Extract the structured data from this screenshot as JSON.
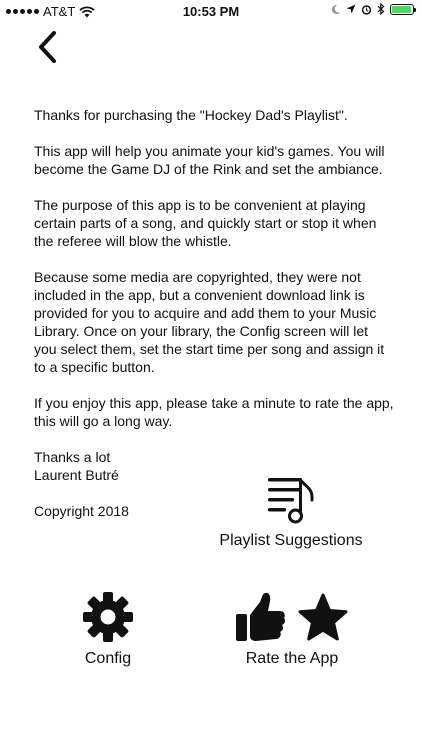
{
  "status_bar": {
    "carrier": "AT&T",
    "time": "10:53 PM",
    "battery_level": 0.95,
    "battery_color": "#4cd964"
  },
  "nav": {
    "back_icon": "chevron-left-icon"
  },
  "content": {
    "paragraphs": [
      "Thanks for purchasing the \"Hockey Dad's Playlist\".",
      "This app will help you animate your kid's games. You will become the Game DJ of the Rink and set the ambiance.",
      "The purpose of this app is to be convenient at playing certain parts of a song, and quickly start or stop it when the referee will blow the whistle.",
      "Because some media are copyrighted, they were not included in the app, but a convenient download link is provided for you to acquire and add them to your Music Library. Once on your library, the Config screen will let you select them, set the start time per song and assign it to a specific button.",
      "If you enjoy this app, please take a minute to rate the app, this will go a long way."
    ],
    "thanks": "Thanks a lot",
    "author": "Laurent Butré",
    "copyright": "Copyright 2018"
  },
  "buttons": {
    "playlist_suggestions": {
      "label": "Playlist Suggestions",
      "icon": "playlist-music-icon"
    },
    "config": {
      "label": "Config",
      "icon": "gear-icon"
    },
    "rate_app": {
      "label": "Rate the App",
      "icons": [
        "thumbs-up-icon",
        "star-icon"
      ]
    }
  }
}
